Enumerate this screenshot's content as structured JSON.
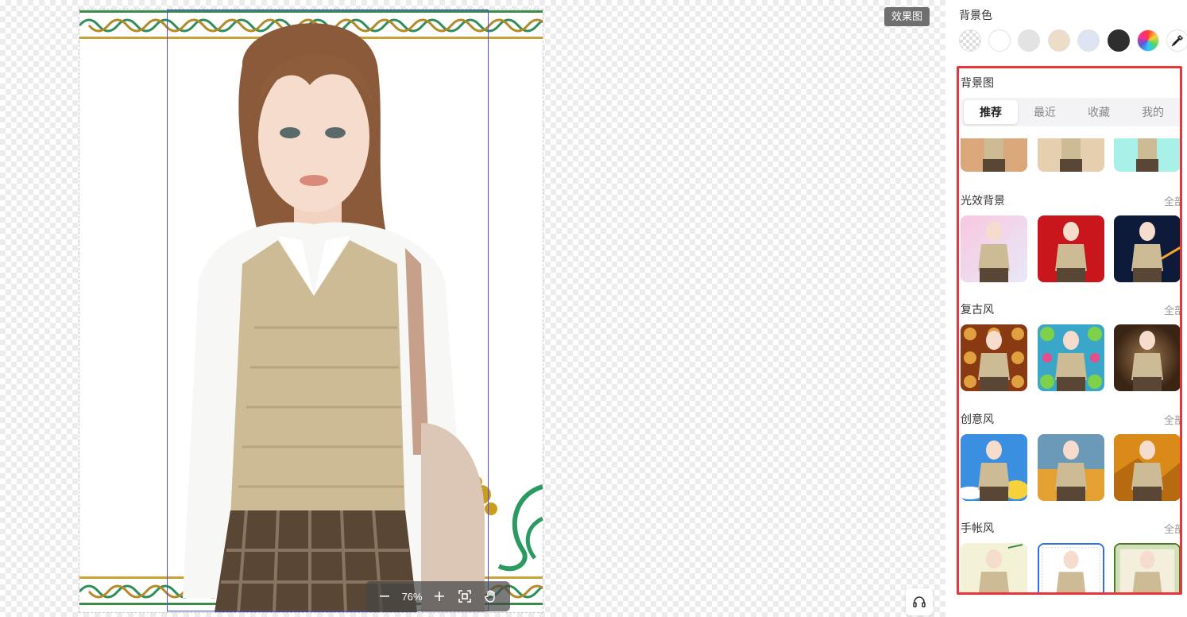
{
  "canvas": {
    "effect_label": "效果图",
    "zoom": {
      "value": "76%"
    }
  },
  "panel": {
    "bg_color_title": "背景色",
    "swatches": [
      {
        "name": "transparent",
        "color": "transparent"
      },
      {
        "name": "white",
        "color": "#ffffff"
      },
      {
        "name": "light-gray",
        "color": "#e3e3e3"
      },
      {
        "name": "beige",
        "color": "#ecdcc8"
      },
      {
        "name": "light-blue",
        "color": "#dde5f4"
      },
      {
        "name": "dark",
        "color": "#2e2e2e"
      },
      {
        "name": "rainbow",
        "color": "multicolor"
      },
      {
        "name": "eyedropper",
        "color": "none"
      }
    ],
    "bg_image_title": "背景图",
    "tabs": [
      "推荐",
      "最近",
      "收藏",
      "我的"
    ],
    "active_tab": "推荐",
    "categories": [
      {
        "title": "光效背景",
        "all": "全部",
        "thumbs": [
          "#f0d6ea",
          "#c9161d",
          "#0e1a3a"
        ]
      },
      {
        "title": "复古风",
        "all": "全部",
        "thumbs": [
          "#8a3a12",
          "#3aa6c8",
          "#5a3a22"
        ]
      },
      {
        "title": "创意风",
        "all": "全部",
        "thumbs": [
          "#3b8fe0",
          "#e4a030",
          "#d98a18"
        ]
      },
      {
        "title": "手帐风",
        "all": "全部",
        "thumbs": [
          "#f4f2d6",
          "#ffffff",
          "#cfe0b8"
        ]
      }
    ],
    "top_row_thumbs": [
      "#d9a77a",
      "#e6cfae",
      "#a8f0e8"
    ],
    "accent_color": "#e8343a",
    "selected_color": "#2f6ee8"
  }
}
